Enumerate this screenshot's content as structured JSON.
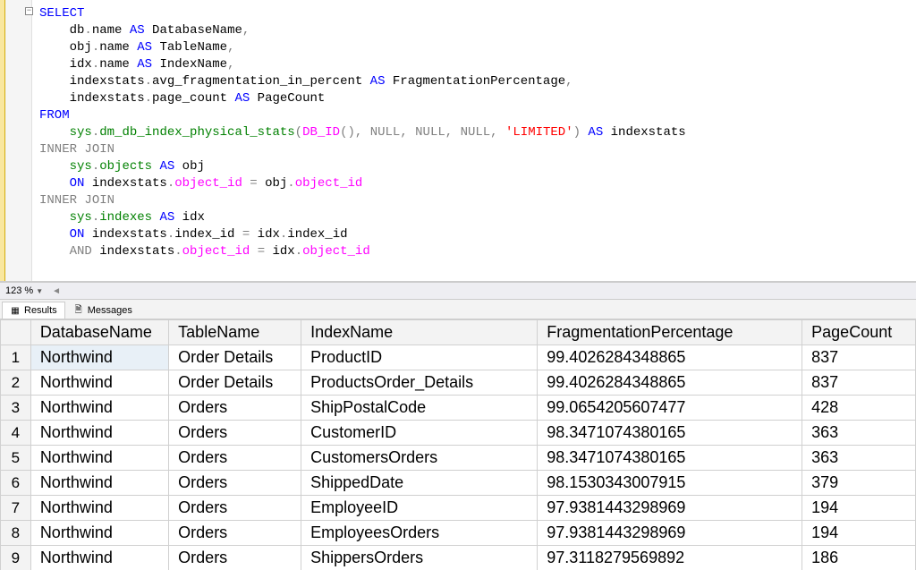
{
  "editor": {
    "collapse_symbol": "−",
    "code_tokens": [
      [
        {
          "t": "SELECT",
          "c": "kw-blue"
        }
      ],
      [
        {
          "t": "    db",
          "c": ""
        },
        {
          "t": ".",
          "c": "kw-gray"
        },
        {
          "t": "name ",
          "c": ""
        },
        {
          "t": "AS",
          "c": "kw-blue"
        },
        {
          "t": " DatabaseName",
          "c": ""
        },
        {
          "t": ",",
          "c": "kw-gray"
        }
      ],
      [
        {
          "t": "    obj",
          "c": ""
        },
        {
          "t": ".",
          "c": "kw-gray"
        },
        {
          "t": "name ",
          "c": ""
        },
        {
          "t": "AS",
          "c": "kw-blue"
        },
        {
          "t": " TableName",
          "c": ""
        },
        {
          "t": ",",
          "c": "kw-gray"
        }
      ],
      [
        {
          "t": "    idx",
          "c": ""
        },
        {
          "t": ".",
          "c": "kw-gray"
        },
        {
          "t": "name ",
          "c": ""
        },
        {
          "t": "AS",
          "c": "kw-blue"
        },
        {
          "t": " IndexName",
          "c": ""
        },
        {
          "t": ",",
          "c": "kw-gray"
        }
      ],
      [
        {
          "t": "    indexstats",
          "c": ""
        },
        {
          "t": ".",
          "c": "kw-gray"
        },
        {
          "t": "avg_fragmentation_in_percent ",
          "c": ""
        },
        {
          "t": "AS",
          "c": "kw-blue"
        },
        {
          "t": " FragmentationPercentage",
          "c": ""
        },
        {
          "t": ",",
          "c": "kw-gray"
        }
      ],
      [
        {
          "t": "    indexstats",
          "c": ""
        },
        {
          "t": ".",
          "c": "kw-gray"
        },
        {
          "t": "page_count ",
          "c": ""
        },
        {
          "t": "AS",
          "c": "kw-blue"
        },
        {
          "t": " PageCount",
          "c": ""
        }
      ],
      [
        {
          "t": "FROM",
          "c": "kw-blue"
        }
      ],
      [
        {
          "t": "    ",
          "c": ""
        },
        {
          "t": "sys",
          "c": "kw-green"
        },
        {
          "t": ".",
          "c": "kw-gray"
        },
        {
          "t": "dm_db_index_physical_stats",
          "c": "kw-green"
        },
        {
          "t": "(",
          "c": "kw-gray"
        },
        {
          "t": "DB_ID",
          "c": "kw-magenta"
        },
        {
          "t": "(),",
          "c": "kw-gray"
        },
        {
          "t": " ",
          "c": ""
        },
        {
          "t": "NULL",
          "c": "kw-gray"
        },
        {
          "t": ",",
          "c": "kw-gray"
        },
        {
          "t": " ",
          "c": ""
        },
        {
          "t": "NULL",
          "c": "kw-gray"
        },
        {
          "t": ",",
          "c": "kw-gray"
        },
        {
          "t": " ",
          "c": ""
        },
        {
          "t": "NULL",
          "c": "kw-gray"
        },
        {
          "t": ",",
          "c": "kw-gray"
        },
        {
          "t": " ",
          "c": ""
        },
        {
          "t": "'LIMITED'",
          "c": "kw-red"
        },
        {
          "t": ")",
          "c": "kw-gray"
        },
        {
          "t": " ",
          "c": ""
        },
        {
          "t": "AS",
          "c": "kw-blue"
        },
        {
          "t": " indexstats",
          "c": ""
        }
      ],
      [
        {
          "t": "INNER",
          "c": "kw-gray"
        },
        {
          "t": " ",
          "c": ""
        },
        {
          "t": "JOIN",
          "c": "kw-gray"
        }
      ],
      [
        {
          "t": "    ",
          "c": ""
        },
        {
          "t": "sys",
          "c": "kw-green"
        },
        {
          "t": ".",
          "c": "kw-gray"
        },
        {
          "t": "objects",
          "c": "kw-green"
        },
        {
          "t": " ",
          "c": ""
        },
        {
          "t": "AS",
          "c": "kw-blue"
        },
        {
          "t": " obj",
          "c": ""
        }
      ],
      [
        {
          "t": "    ",
          "c": ""
        },
        {
          "t": "ON",
          "c": "kw-blue"
        },
        {
          "t": " indexstats",
          "c": ""
        },
        {
          "t": ".",
          "c": "kw-gray"
        },
        {
          "t": "object_id",
          "c": "kw-magenta"
        },
        {
          "t": " ",
          "c": ""
        },
        {
          "t": "=",
          "c": "kw-gray"
        },
        {
          "t": " obj",
          "c": ""
        },
        {
          "t": ".",
          "c": "kw-gray"
        },
        {
          "t": "object_id",
          "c": "kw-magenta"
        }
      ],
      [
        {
          "t": "INNER",
          "c": "kw-gray"
        },
        {
          "t": " ",
          "c": ""
        },
        {
          "t": "JOIN",
          "c": "kw-gray"
        }
      ],
      [
        {
          "t": "    ",
          "c": ""
        },
        {
          "t": "sys",
          "c": "kw-green"
        },
        {
          "t": ".",
          "c": "kw-gray"
        },
        {
          "t": "indexes",
          "c": "kw-green"
        },
        {
          "t": " ",
          "c": ""
        },
        {
          "t": "AS",
          "c": "kw-blue"
        },
        {
          "t": " idx",
          "c": ""
        }
      ],
      [
        {
          "t": "    ",
          "c": ""
        },
        {
          "t": "ON",
          "c": "kw-blue"
        },
        {
          "t": " indexstats",
          "c": ""
        },
        {
          "t": ".",
          "c": "kw-gray"
        },
        {
          "t": "index_id ",
          "c": ""
        },
        {
          "t": "=",
          "c": "kw-gray"
        },
        {
          "t": " idx",
          "c": ""
        },
        {
          "t": ".",
          "c": "kw-gray"
        },
        {
          "t": "index_id",
          "c": ""
        }
      ],
      [
        {
          "t": "    ",
          "c": ""
        },
        {
          "t": "AND",
          "c": "kw-gray"
        },
        {
          "t": " indexstats",
          "c": ""
        },
        {
          "t": ".",
          "c": "kw-gray"
        },
        {
          "t": "object_id",
          "c": "kw-magenta"
        },
        {
          "t": " ",
          "c": ""
        },
        {
          "t": "=",
          "c": "kw-gray"
        },
        {
          "t": " idx",
          "c": ""
        },
        {
          "t": ".",
          "c": "kw-gray"
        },
        {
          "t": "object_id",
          "c": "kw-magenta"
        }
      ]
    ]
  },
  "zoom": {
    "value": "123 %"
  },
  "tabs": {
    "results": "Results",
    "messages": "Messages"
  },
  "grid": {
    "headers": [
      "DatabaseName",
      "TableName",
      "IndexName",
      "FragmentationPercentage",
      "PageCount"
    ],
    "rows": [
      {
        "n": "1",
        "cells": [
          "Northwind",
          "Order Details",
          "ProductID",
          "99.4026284348865",
          "837"
        ],
        "selected": true
      },
      {
        "n": "2",
        "cells": [
          "Northwind",
          "Order Details",
          "ProductsOrder_Details",
          "99.4026284348865",
          "837"
        ]
      },
      {
        "n": "3",
        "cells": [
          "Northwind",
          "Orders",
          "ShipPostalCode",
          "99.0654205607477",
          "428"
        ]
      },
      {
        "n": "4",
        "cells": [
          "Northwind",
          "Orders",
          "CustomerID",
          "98.3471074380165",
          "363"
        ]
      },
      {
        "n": "5",
        "cells": [
          "Northwind",
          "Orders",
          "CustomersOrders",
          "98.3471074380165",
          "363"
        ]
      },
      {
        "n": "6",
        "cells": [
          "Northwind",
          "Orders",
          "ShippedDate",
          "98.1530343007915",
          "379"
        ]
      },
      {
        "n": "7",
        "cells": [
          "Northwind",
          "Orders",
          "EmployeeID",
          "97.9381443298969",
          "194"
        ]
      },
      {
        "n": "8",
        "cells": [
          "Northwind",
          "Orders",
          "EmployeesOrders",
          "97.9381443298969",
          "194"
        ]
      },
      {
        "n": "9",
        "cells": [
          "Northwind",
          "Orders",
          "ShippersOrders",
          "97.3118279569892",
          "186"
        ]
      }
    ]
  }
}
